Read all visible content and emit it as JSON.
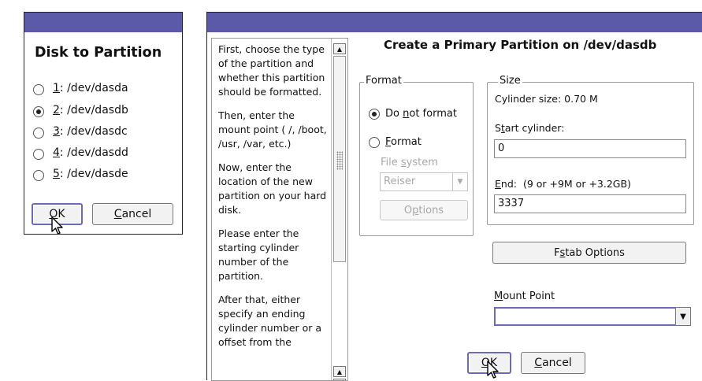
{
  "disk_dialog": {
    "title": "Disk to Partition",
    "options": [
      {
        "key": "1",
        "label": ": /dev/dasda",
        "selected": false
      },
      {
        "key": "2",
        "label": ": /dev/dasdb",
        "selected": true
      },
      {
        "key": "3",
        "label": ": /dev/dasdc",
        "selected": false
      },
      {
        "key": "4",
        "label": ": /dev/dasdd",
        "selected": false
      },
      {
        "key": "5",
        "label": ": /dev/dasde",
        "selected": false
      }
    ],
    "ok": {
      "key": "O",
      "rest": "K"
    },
    "cancel": {
      "key": "C",
      "rest": "ancel"
    }
  },
  "partition_dialog": {
    "title": "Create a Primary Partition on /dev/dasdb",
    "help_paragraphs": [
      "First, choose the type of the partition and whether this partition should be formatted.",
      "Then, enter the mount point ( /, /boot, /usr, /var, etc.)",
      "Now, enter the location of the new partition on your hard disk.",
      "Please enter the starting cylinder number of the partition.",
      "After that, either specify an ending cylinder number or a offset from the"
    ],
    "format": {
      "legend": "Format",
      "do_not_format": {
        "pre": "Do ",
        "key": "n",
        "post": "ot format",
        "selected": true
      },
      "format": {
        "pre": "",
        "key": "F",
        "post": "ormat",
        "selected": false
      },
      "file_system_label": {
        "pre": "File ",
        "key": "s",
        "post": "ystem"
      },
      "file_system_value": "Reiser",
      "options": {
        "pre": "O",
        "key": "p",
        "post": "tions"
      }
    },
    "size": {
      "legend": "Size",
      "cylinder_size": "Cylinder size: 0.70 M",
      "start_label": {
        "pre": "S",
        "key": "t",
        "post": "art cylinder:"
      },
      "start_value": "0",
      "end_label": {
        "pre": "",
        "key": "E",
        "post": "nd:",
        "hint": "(9 or +9M or +3.2GB)"
      },
      "end_value": "3337"
    },
    "fstab": {
      "pre": "F",
      "key": "s",
      "post": "tab Options"
    },
    "mount_point": {
      "pre": "",
      "key": "M",
      "post": "ount Point",
      "value": ""
    },
    "ok": {
      "key": "O",
      "rest": "K"
    },
    "cancel": {
      "key": "C",
      "rest": "ancel"
    }
  },
  "colors": {
    "titlebar": "#5a5aa8",
    "focus": "#6a6ab8"
  }
}
